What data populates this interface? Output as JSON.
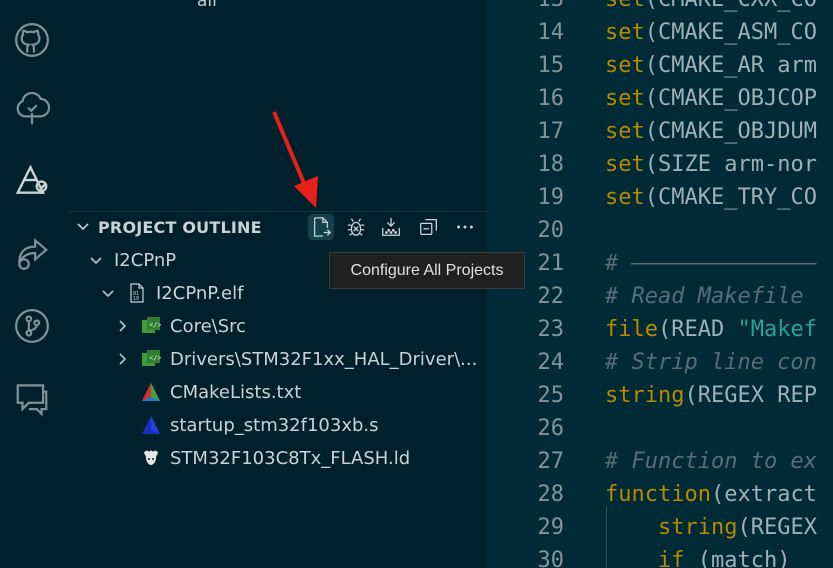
{
  "activity_bar": {
    "items": [
      {
        "icon": "github-icon"
      },
      {
        "icon": "tree-icon"
      },
      {
        "icon": "stm32-icon",
        "active": true
      },
      {
        "icon": "remote-share-icon"
      },
      {
        "icon": "source-control-icon"
      },
      {
        "icon": "chat-icon"
      }
    ]
  },
  "sidebar": {
    "top_item": "all",
    "section_title": "PROJECT OUTLINE",
    "tooltip": "Configure All Projects",
    "tree": [
      {
        "label": "I2CPnP",
        "level": 0,
        "twisty": "open",
        "icon": "none"
      },
      {
        "label": "I2CPnP.elf",
        "level": 1,
        "twisty": "open",
        "icon": "binary-file-icon"
      },
      {
        "label": "Core\\Src",
        "level": 2,
        "twisty": "closed",
        "icon": "cmake-target-icon"
      },
      {
        "label": "Drivers\\STM32F1xx_HAL_Driver\\...",
        "level": 2,
        "twisty": "closed",
        "icon": "cmake-target-icon"
      },
      {
        "label": "CMakeLists.txt",
        "level": 2,
        "twisty": "none",
        "icon": "cmake-icon"
      },
      {
        "label": "startup_stm32f103xb.s",
        "level": 2,
        "twisty": "none",
        "icon": "asm-icon"
      },
      {
        "label": "STM32F103C8Tx_FLASH.ld",
        "level": 2,
        "twisty": "none",
        "icon": "linker-gnu-icon"
      }
    ]
  },
  "editor": {
    "lines": [
      {
        "num": "13",
        "parts": [
          [
            "kw",
            "set"
          ],
          [
            "pl",
            "(CMAKE_CXX_CO"
          ]
        ]
      },
      {
        "num": "14",
        "parts": [
          [
            "kw",
            "set"
          ],
          [
            "pl",
            "(CMAKE_ASM_CO"
          ]
        ]
      },
      {
        "num": "15",
        "parts": [
          [
            "kw",
            "set"
          ],
          [
            "pl",
            "(CMAKE_AR arm"
          ]
        ]
      },
      {
        "num": "16",
        "parts": [
          [
            "kw",
            "set"
          ],
          [
            "pl",
            "(CMAKE_OBJCOP"
          ]
        ]
      },
      {
        "num": "17",
        "parts": [
          [
            "kw",
            "set"
          ],
          [
            "pl",
            "(CMAKE_OBJDUM"
          ]
        ]
      },
      {
        "num": "18",
        "parts": [
          [
            "kw",
            "set"
          ],
          [
            "pl",
            "(SIZE arm-nor"
          ]
        ]
      },
      {
        "num": "19",
        "parts": [
          [
            "kw",
            "set"
          ],
          [
            "pl",
            "(CMAKE_TRY_CO"
          ]
        ]
      },
      {
        "num": "20",
        "parts": []
      },
      {
        "num": "21",
        "parts": [
          [
            "cm",
            "# ——————————————"
          ]
        ]
      },
      {
        "num": "22",
        "parts": [
          [
            "cm",
            "# Read Makefile"
          ]
        ]
      },
      {
        "num": "23",
        "parts": [
          [
            "kw",
            "file"
          ],
          [
            "pl",
            "(READ "
          ],
          [
            "st",
            "\"Makef"
          ]
        ]
      },
      {
        "num": "24",
        "parts": [
          [
            "cm",
            "# Strip line con"
          ]
        ]
      },
      {
        "num": "25",
        "parts": [
          [
            "kw",
            "string"
          ],
          [
            "pl",
            "(REGEX REP"
          ]
        ]
      },
      {
        "num": "26",
        "parts": []
      },
      {
        "num": "27",
        "parts": [
          [
            "cm",
            "# Function to ex"
          ]
        ]
      },
      {
        "num": "28",
        "parts": [
          [
            "kw",
            "function"
          ],
          [
            "pl",
            "(extract"
          ]
        ]
      },
      {
        "num": "29",
        "parts": [
          [
            "pl",
            "    "
          ],
          [
            "kw",
            "string"
          ],
          [
            "pl",
            "(REGEX"
          ]
        ]
      },
      {
        "num": "30",
        "parts": [
          [
            "pl",
            "    "
          ],
          [
            "kw",
            "if"
          ],
          [
            "pl",
            " (match)"
          ]
        ]
      }
    ]
  }
}
